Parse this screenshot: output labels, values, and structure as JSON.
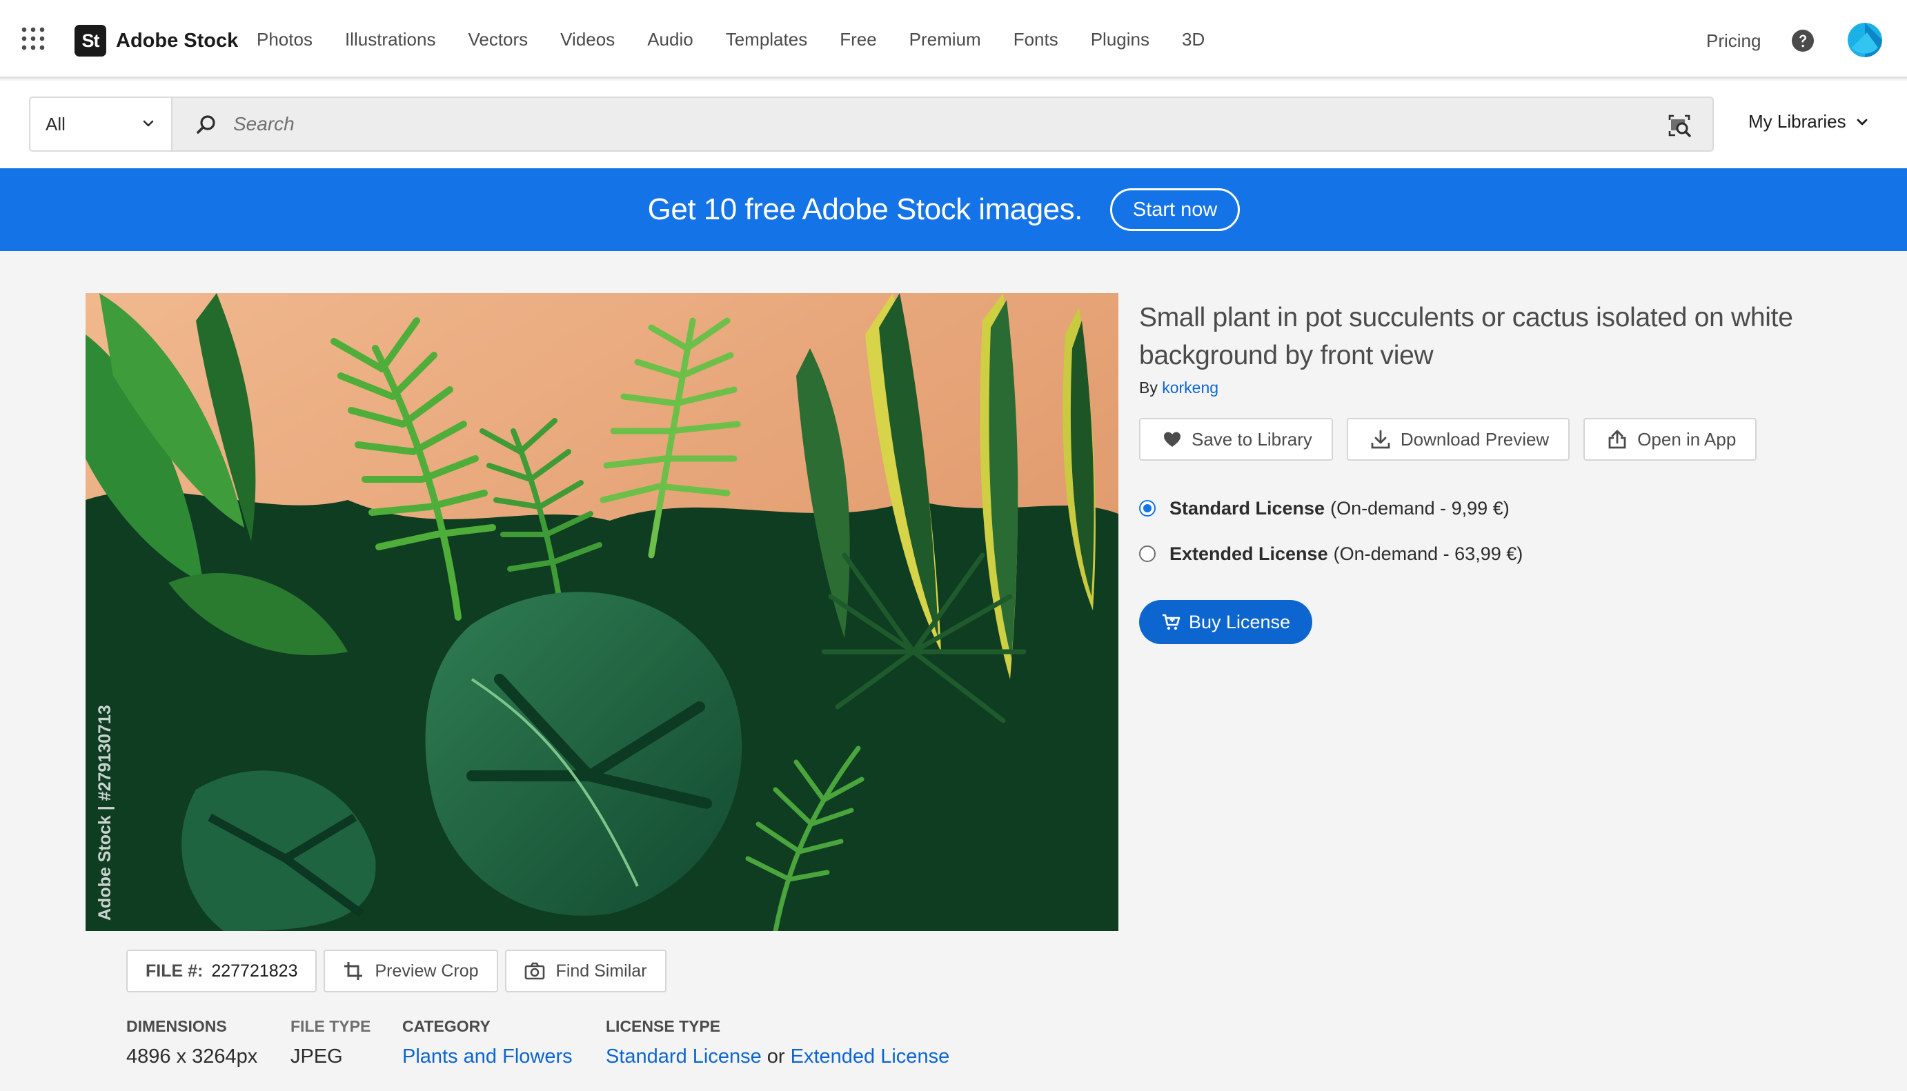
{
  "header": {
    "apps_icon": "app-grid-icon",
    "brand_logo": "St",
    "brand_name": "Adobe Stock",
    "nav": [
      "Photos",
      "Illustrations",
      "Vectors",
      "Videos",
      "Audio",
      "Templates",
      "Free",
      "Premium",
      "Fonts",
      "Plugins",
      "3D"
    ],
    "pricing": "Pricing",
    "help_icon": "help-circle-icon",
    "avatar_icon": "user-avatar"
  },
  "search": {
    "scope": "All",
    "placeholder": "Search",
    "value": "",
    "visual_search_icon": "visual-search-icon",
    "my_libraries": "My Libraries"
  },
  "promo": {
    "text": "Get 10 free Adobe Stock images.",
    "button": "Start now",
    "color": "#1473e6"
  },
  "image": {
    "watermark": "Adobe Stock | #279130713"
  },
  "tools": {
    "file_label": "FILE #:",
    "file_value": "227721823",
    "preview_crop": "Preview Crop",
    "find_similar": "Find Similar"
  },
  "meta": {
    "dimensions_label": "DIMENSIONS",
    "dimensions_value": "4896 x 3264px",
    "filetype_label": "FILE TYPE",
    "filetype_value": "JPEG",
    "category_label": "CATEGORY",
    "category_value": "Plants and Flowers",
    "license_label": "LICENSE TYPE",
    "license_standard": "Standard License",
    "license_or": "or",
    "license_extended": "Extended License"
  },
  "detail": {
    "title": "Small plant in pot succulents or cactus isolated on white background by front view",
    "by": "By",
    "author": "korkeng",
    "save_to_library": "Save to Library",
    "download_preview": "Download Preview",
    "open_in_app": "Open in App",
    "licenses": [
      {
        "name": "Standard License",
        "price": "(On-demand - 9,99 €)",
        "selected": true
      },
      {
        "name": "Extended License",
        "price": "(On-demand - 63,99 €)",
        "selected": false
      }
    ],
    "buy": "Buy License",
    "accent": "#0d66d0"
  }
}
